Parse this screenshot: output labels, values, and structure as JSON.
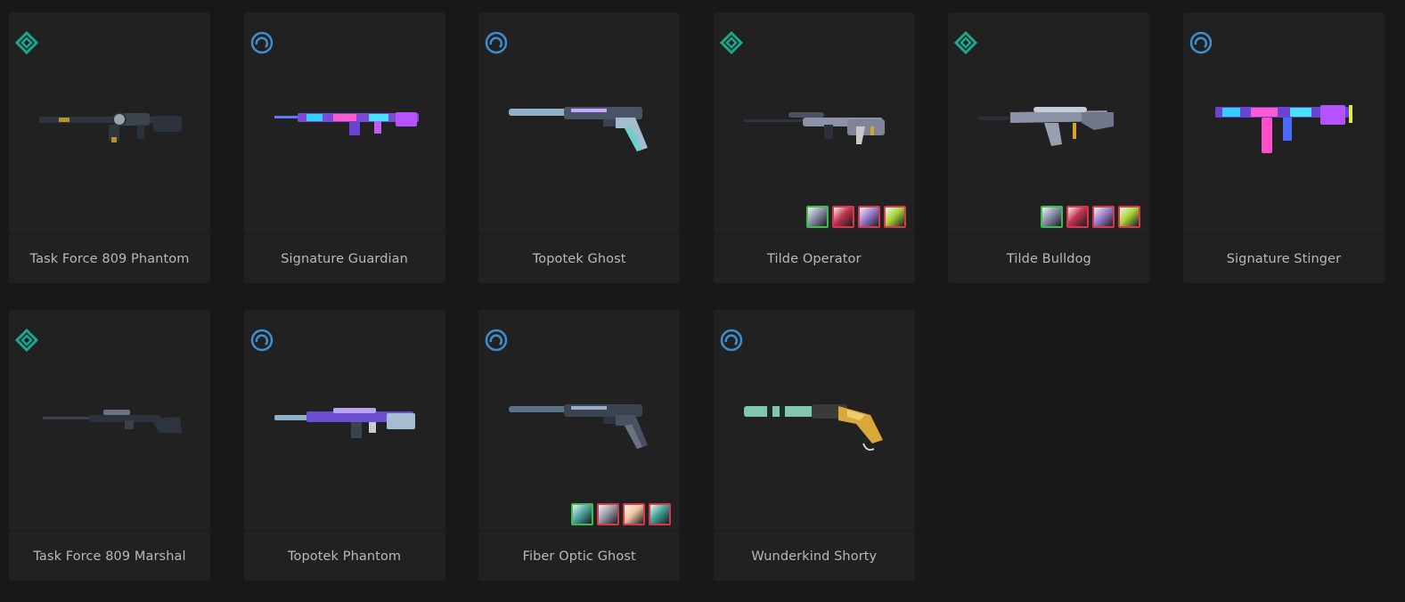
{
  "colors": {
    "background": "#181818",
    "card": "#212121",
    "text": "#b9b9b9",
    "tier_premium": "#1aa88d",
    "tier_deluxe": "#3e8ed0",
    "chroma_selected_border": "#3bbd4f",
    "chroma_border": "#d63a4a"
  },
  "cards": [
    {
      "name": "Task Force 809 Phantom",
      "tier_icon": "premium-tier-icon",
      "chromas": []
    },
    {
      "name": "Signature Guardian",
      "tier_icon": "deluxe-tier-icon",
      "chromas": []
    },
    {
      "name": "Topotek Ghost",
      "tier_icon": "deluxe-tier-icon",
      "chromas": []
    },
    {
      "name": "Tilde Operator",
      "tier_icon": "premium-tier-icon",
      "chromas": [
        "#8a8fa8",
        "#c1334f",
        "#9a7fd0",
        "#a9d63a"
      ]
    },
    {
      "name": "Tilde Bulldog",
      "tier_icon": "premium-tier-icon",
      "chromas": [
        "#8a8fa8",
        "#c1334f",
        "#9a7fd0",
        "#a9d63a"
      ]
    },
    {
      "name": "Signature Stinger",
      "tier_icon": "deluxe-tier-icon",
      "chromas": []
    },
    {
      "name": "Task Force 809 Marshal",
      "tier_icon": "premium-tier-icon",
      "chromas": []
    },
    {
      "name": "Topotek Phantom",
      "tier_icon": "deluxe-tier-icon",
      "chromas": []
    },
    {
      "name": "Fiber Optic Ghost",
      "tier_icon": "deluxe-tier-icon",
      "chromas": [
        "#4fa7a0",
        "#9a9ca8",
        "#f0c7a0",
        "#3fa59a"
      ]
    },
    {
      "name": "Wunderkind Shorty",
      "tier_icon": "deluxe-tier-icon",
      "chromas": []
    }
  ]
}
